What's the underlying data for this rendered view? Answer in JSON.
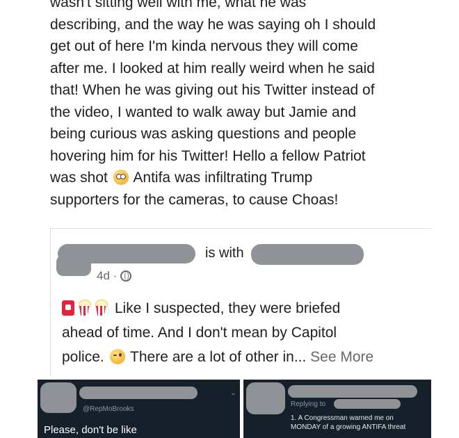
{
  "post": {
    "lines": [
      "wasn't sitting well with me, what he was",
      "describing, and the way he was saying oh I should",
      "get out of here I'm kinda nervous they will come",
      "after me. I looked at him really weird when he said",
      "that! When he was giving out his Twitter instead of",
      "the video, I wanted to walk away but Jamie and",
      "being curious was asking questions and people",
      "hovering him for his Twitter! Hello a fellow Patriot"
    ],
    "line9_before": "was shot",
    "line9_after": "Antifa was infiltrating Trump",
    "line10": "supporters for the cameras, to cause Choas!",
    "emoji_icon": "flushed-face-emoji"
  },
  "shared_post": {
    "is_with": "is with",
    "time": "4d ·",
    "privacy_icon": "globe-icon",
    "body_line1": "Like I suspected, they were briefed",
    "body_line2": "ahead of time. And I don't mean by Capitol",
    "body_line3": "police.",
    "body_line3_after": "There are a lot of other in...",
    "see_more": "See More",
    "emoji_icons": [
      "stop-sign-emoji",
      "popcorn-emoji",
      "popcorn-emoji",
      "winking-face-emoji"
    ]
  },
  "tweet_left": {
    "handle": "@RepMoBrooks",
    "text": "Please, don't be like"
  },
  "tweet_right": {
    "replying": "Replying to",
    "line1": "1. A Congressman warned me on",
    "line2": "MONDAY of a growing ANTIFA threat"
  },
  "colors": {
    "text": "#1c1e21",
    "meta": "#65676b",
    "redaction": "#8f9397",
    "tweet_bg": "#15202b"
  }
}
